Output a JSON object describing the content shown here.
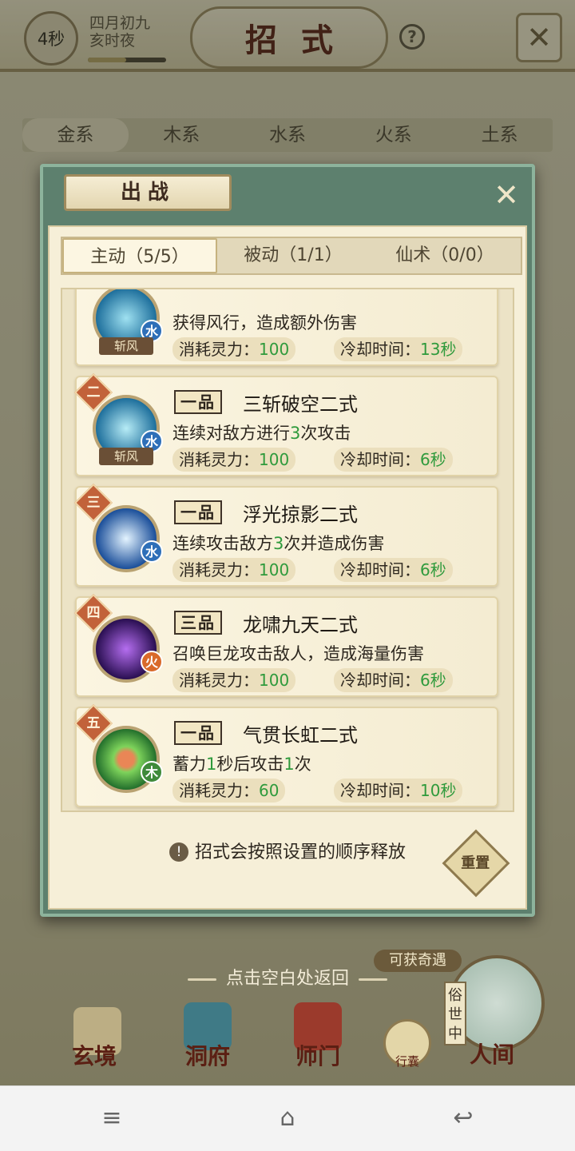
{
  "top": {
    "timer": "4秒",
    "date_line1": "四月初九",
    "date_line2": "亥时夜",
    "title": "招式",
    "help": "?"
  },
  "element_tabs": [
    "金系",
    "木系",
    "水系",
    "火系",
    "土系"
  ],
  "dialog": {
    "title": "出战",
    "tabs": [
      "主动（5/5）",
      "被动（1/1）",
      "仙术（0/0）"
    ],
    "skills": [
      {
        "rank": "",
        "tier": "",
        "name": "",
        "icon_caption": "斩风",
        "element": "水",
        "desc": [
          "获得风行，造成额外伤害"
        ],
        "mana_label": "消耗灵力：",
        "mana": "100",
        "cd_label": "冷却时间：",
        "cd": "13秒"
      },
      {
        "rank": "二",
        "tier": "一品",
        "name": "三斩破空二式",
        "icon_caption": "斩风",
        "element": "水",
        "desc": [
          "连续对敌方进行",
          "3",
          "次攻击"
        ],
        "mana_label": "消耗灵力：",
        "mana": "100",
        "cd_label": "冷却时间：",
        "cd": "6秒"
      },
      {
        "rank": "三",
        "tier": "一品",
        "name": "浮光掠影二式",
        "icon_caption": "",
        "element": "水",
        "desc": [
          "连续攻击敌方",
          "3",
          "次并造成伤害"
        ],
        "mana_label": "消耗灵力：",
        "mana": "100",
        "cd_label": "冷却时间：",
        "cd": "6秒"
      },
      {
        "rank": "四",
        "tier": "三品",
        "name": "龙啸九天二式",
        "icon_caption": "",
        "element": "火",
        "desc": [
          "召唤巨龙攻击敌人，造成海量伤害"
        ],
        "mana_label": "消耗灵力：",
        "mana": "100",
        "cd_label": "冷却时间：",
        "cd": "6秒"
      },
      {
        "rank": "五",
        "tier": "一品",
        "name": "气贯长虹二式",
        "icon_caption": "",
        "element": "木",
        "desc": [
          "蓄力",
          "1",
          "秒后攻击",
          "1",
          "次"
        ],
        "mana_label": "消耗灵力：",
        "mana": "60",
        "cd_label": "冷却时间：",
        "cd": "10秒"
      }
    ],
    "tip": "招式会按照设置的顺序释放",
    "tip_icon": "!",
    "reset": "重置"
  },
  "return_hint": "点击空白处返回",
  "bottom_nav": {
    "items": [
      "玄境",
      "洞府",
      "师门"
    ],
    "bag": "行囊",
    "world": "人间",
    "world_tag": "俗世中",
    "chip": "可获奇遇"
  },
  "system_bar": {
    "menu": "≡",
    "home": "⌂",
    "back": "↩"
  },
  "colors": {
    "accent_green": "#2f9a3c",
    "panel_green": "#5d806e",
    "title_red": "#5a2015"
  }
}
